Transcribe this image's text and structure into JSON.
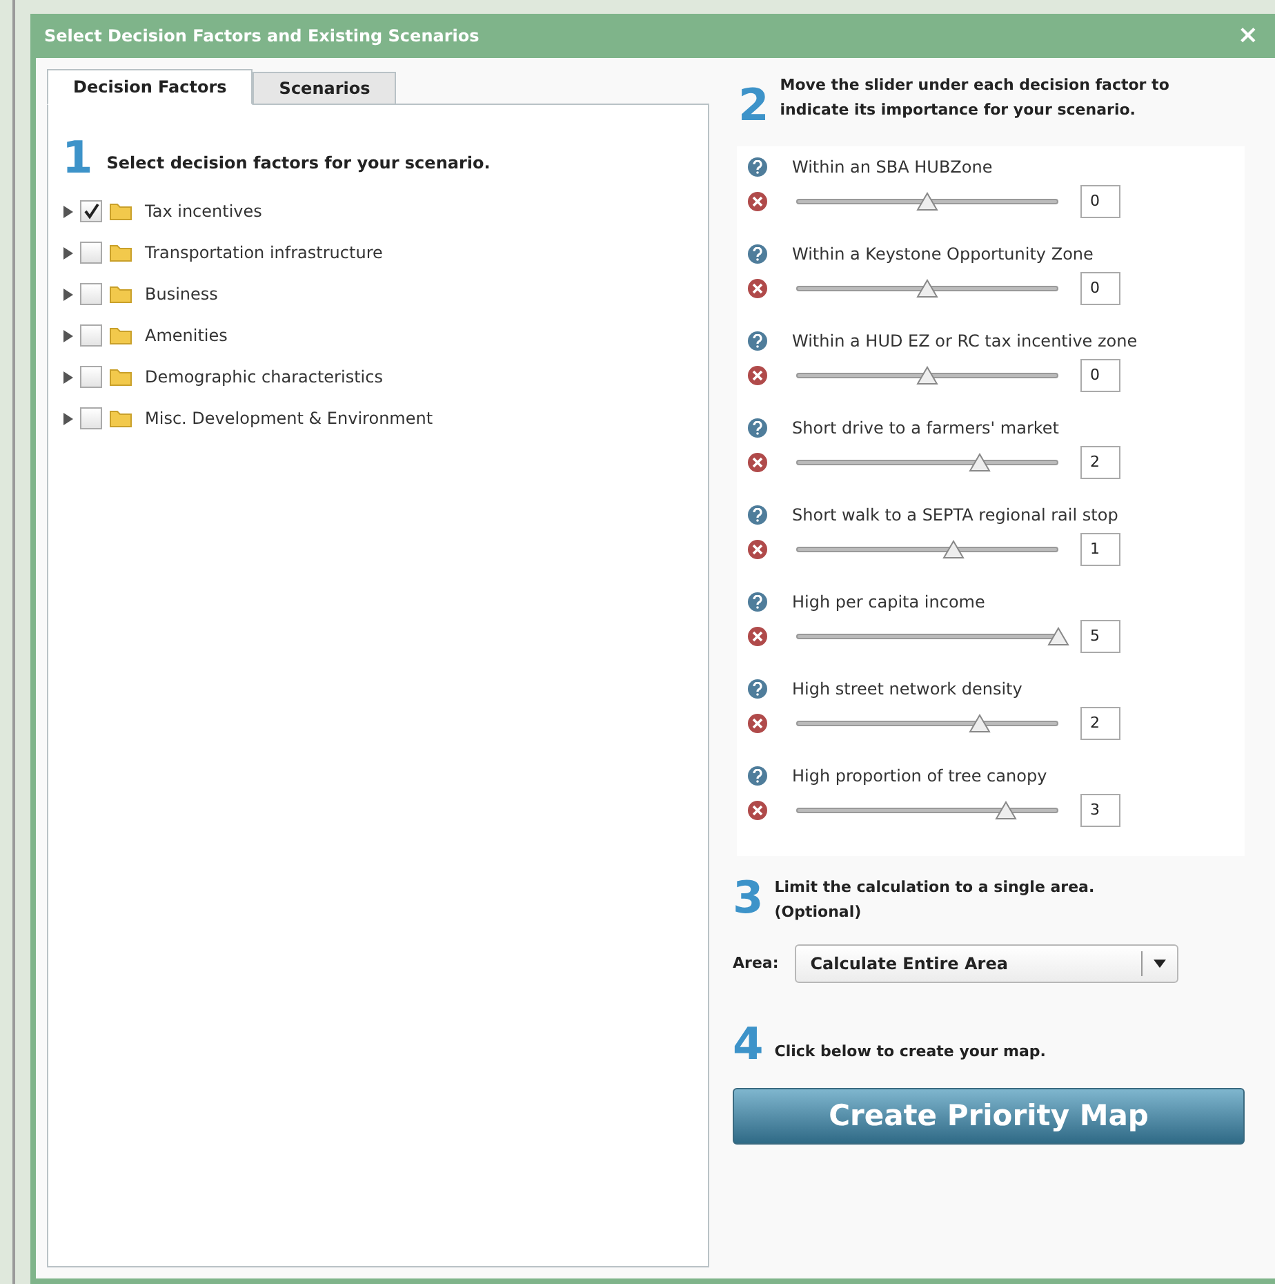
{
  "window": {
    "title": "Select Decision Factors and Existing Scenarios",
    "close": "×"
  },
  "tabs": [
    {
      "label": "Decision Factors",
      "selected": true
    },
    {
      "label": "Scenarios",
      "selected": false
    }
  ],
  "step1": {
    "number": "1",
    "text": "Select decision factors for your scenario."
  },
  "factors": [
    {
      "label": "Tax incentives",
      "checked": true,
      "expanded": false
    },
    {
      "label": "Transportation infrastructure",
      "checked": false,
      "expanded": false
    },
    {
      "label": "Business",
      "checked": false,
      "expanded": false
    },
    {
      "label": "Amenities",
      "checked": false,
      "expanded": false
    },
    {
      "label": "Demographic characteristics",
      "checked": false,
      "expanded": false
    },
    {
      "label": "Misc. Development & Environment",
      "checked": false,
      "expanded": false
    }
  ],
  "step2": {
    "number": "2",
    "text": "Move the slider under each decision factor to indicate its importance for your scenario."
  },
  "sliders": [
    {
      "label": "Within an SBA HUBZone",
      "level": 0.5,
      "value": "0"
    },
    {
      "label": "Within a Keystone Opportunity Zone",
      "level": 0.5,
      "value": "0"
    },
    {
      "label": "Within a HUD EZ or RC tax incentive zone",
      "level": 0.5,
      "value": "0"
    },
    {
      "label": "Short drive to a farmers' market",
      "level": 0.7,
      "value": "2"
    },
    {
      "label": "Short walk to a SEPTA regional rail stop",
      "level": 0.6,
      "value": "1"
    },
    {
      "label": "High per capita income",
      "level": 1.0,
      "value": "5"
    },
    {
      "label": "High street network density",
      "level": 0.7,
      "value": "2"
    },
    {
      "label": "High proportion of tree canopy",
      "level": 0.8,
      "value": "3"
    }
  ],
  "step3": {
    "number": "3",
    "text": "Limit the calculation to a single area. (Optional)"
  },
  "area": {
    "label": "Area:",
    "value": "Calculate Entire Area"
  },
  "step4": {
    "number": "4",
    "text": "Click below to create your map."
  },
  "create_button": "Create Priority Map"
}
